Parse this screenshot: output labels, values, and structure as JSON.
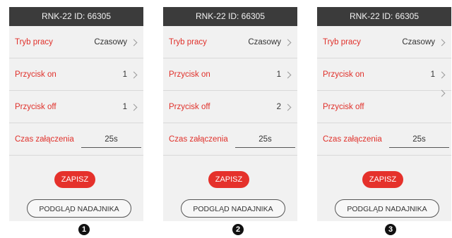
{
  "caption": "",
  "panels": [
    {
      "title": "RNK-22 ID: 66305",
      "mode_label": "Tryb pracy",
      "mode_value": "Czasowy",
      "on_label": "Przycisk on",
      "on_value": "1",
      "off_label": "Przycisk off",
      "off_value": "1",
      "time_label": "Czas załączenia",
      "time_value": "25s",
      "save_label": "ZAPISZ",
      "preview_label": "PODGLĄD NADAJNIKA",
      "number": "1"
    },
    {
      "title": "RNK-22 ID: 66305",
      "mode_label": "Tryb pracy",
      "mode_value": "Czasowy",
      "on_label": "Przycisk on",
      "on_value": "1",
      "off_label": "Przycisk off",
      "off_value": "2",
      "time_label": "Czas załączenia",
      "time_value": "25s",
      "save_label": "ZAPISZ",
      "preview_label": "PODGLĄD NADAJNIKA",
      "number": "2"
    },
    {
      "title": "RNK-22 ID: 66305",
      "mode_label": "Tryb pracy",
      "mode_value": "Czasowy",
      "on_label": "Przycisk on",
      "on_value": "1",
      "off_label": "Przycisk off",
      "off_value": "",
      "time_label": "Czas załączenia",
      "time_value": "25s",
      "save_label": "ZAPISZ",
      "preview_label": "PODGLĄD NADAJNIKA",
      "number": "3"
    }
  ],
  "colors": {
    "accent_red": "#e5312b",
    "label_red": "#e0302a",
    "titlebar": "#3b3b3b",
    "panel_bg": "#f1f1f1"
  },
  "icons": {
    "row_chevron": "chevron-right-icon",
    "step_marker": "numbered-circle-icon"
  }
}
